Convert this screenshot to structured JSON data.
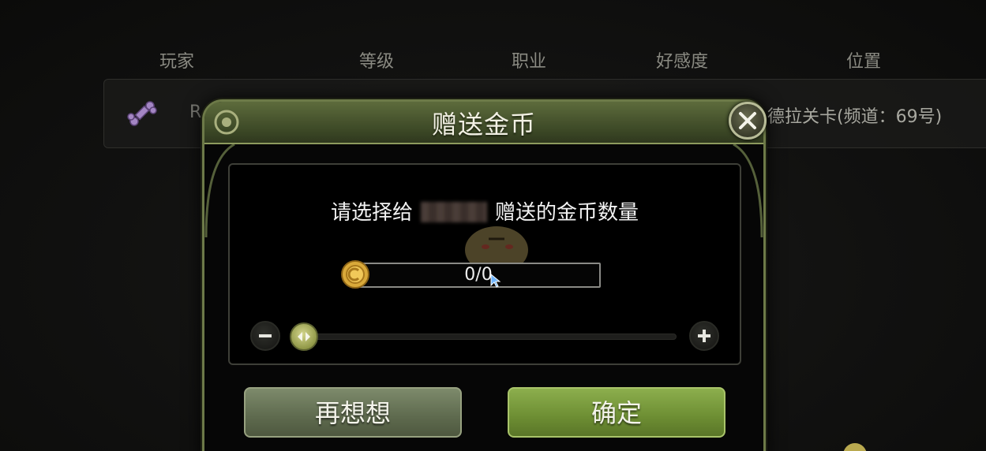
{
  "table": {
    "headers": [
      "玩家",
      "等级",
      "职业",
      "好感度",
      "位置"
    ],
    "row": {
      "name_partial": "R",
      "location": "德拉关卡(频道：69号)"
    }
  },
  "dialog": {
    "title": "赠送金币",
    "prompt_prefix": "请选择给",
    "prompt_suffix": "赠送的金币数量",
    "amount": "0/0",
    "slider_value": 0,
    "cancel_label": "再想想",
    "confirm_label": "确定"
  },
  "icons": {
    "close": "close-icon",
    "coin": "gold-coin-icon",
    "minus": "minus-icon",
    "plus": "plus-icon",
    "slider_handle": "arrows-horizontal-icon",
    "row": "bone-icon"
  },
  "colors": {
    "frame": "#6d7a48",
    "header": "#3c4826",
    "confirm": "#6d8e33",
    "cancel": "#5e6a4e"
  }
}
